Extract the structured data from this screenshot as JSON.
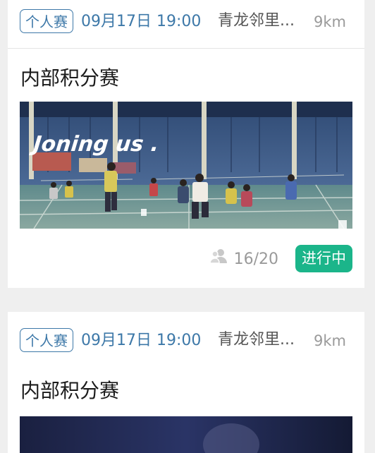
{
  "events": [
    {
      "tag": "个人赛",
      "datetime": "09月17日 19:00",
      "venue": "青龙邻里...",
      "distance": "9km",
      "title": "内部积分赛",
      "photo_caption": "Joning us .",
      "participants": "16/20",
      "status": "进行中"
    },
    {
      "tag": "个人赛",
      "datetime": "09月17日 19:00",
      "venue": "青龙邻里...",
      "distance": "9km",
      "title": "内部积分赛"
    }
  ],
  "colors": {
    "accent_blue": "#3d78a8",
    "status_green": "#1bb58a",
    "page_bg": "#efefef"
  },
  "icons": {
    "participants": "group-people-icon"
  }
}
